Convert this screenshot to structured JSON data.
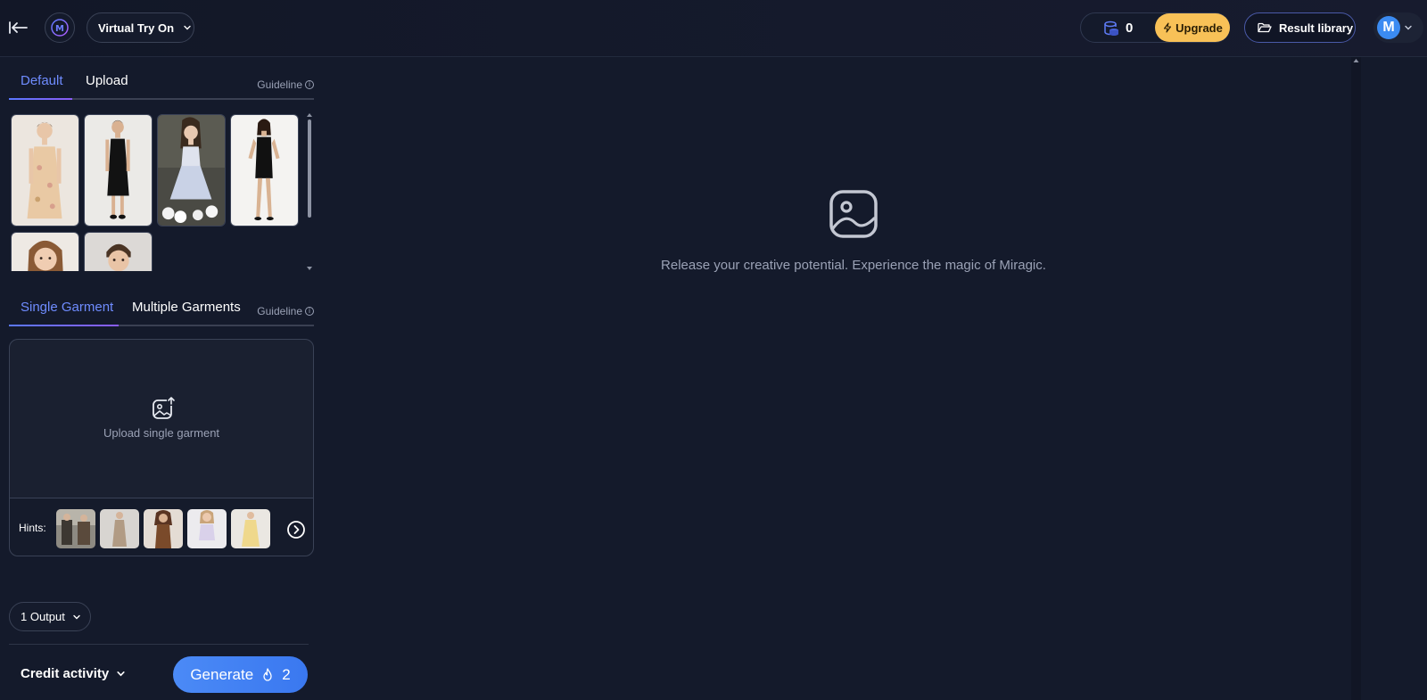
{
  "header": {
    "tool_name": "Virtual Try On",
    "credits": "0",
    "upgrade_label": "Upgrade",
    "result_library_label": "Result library",
    "avatar_initial": "M"
  },
  "model_section": {
    "tabs": [
      {
        "label": "Default",
        "active": true
      },
      {
        "label": "Upload",
        "active": false
      }
    ],
    "guideline_label": "Guideline",
    "models": [
      "floral slip dress",
      "black slip dress",
      "white tulle mini dress",
      "black bodycon dress",
      "child girl",
      "child boy"
    ]
  },
  "garment_section": {
    "tabs": [
      {
        "label": "Single Garment",
        "active": true
      },
      {
        "label": "Multiple Garments",
        "active": false
      }
    ],
    "guideline_label": "Guideline",
    "upload_text": "Upload single garment",
    "hints_label": "Hints:",
    "hints": [
      "street outfit",
      "beige knit dress",
      "brown outfit",
      "lilac top",
      "yellow dress"
    ]
  },
  "output_label": "1 Output",
  "credit_activity_label": "Credit activity",
  "generate": {
    "label": "Generate",
    "cost": "2"
  },
  "main": {
    "empty_text": "Release your creative potential. Experience the magic of Miragic."
  },
  "colors": {
    "background": "#141a2b",
    "accent_blue": "#3b82f6",
    "active_tab": "#6f8cff",
    "upgrade": "#f8c157"
  }
}
